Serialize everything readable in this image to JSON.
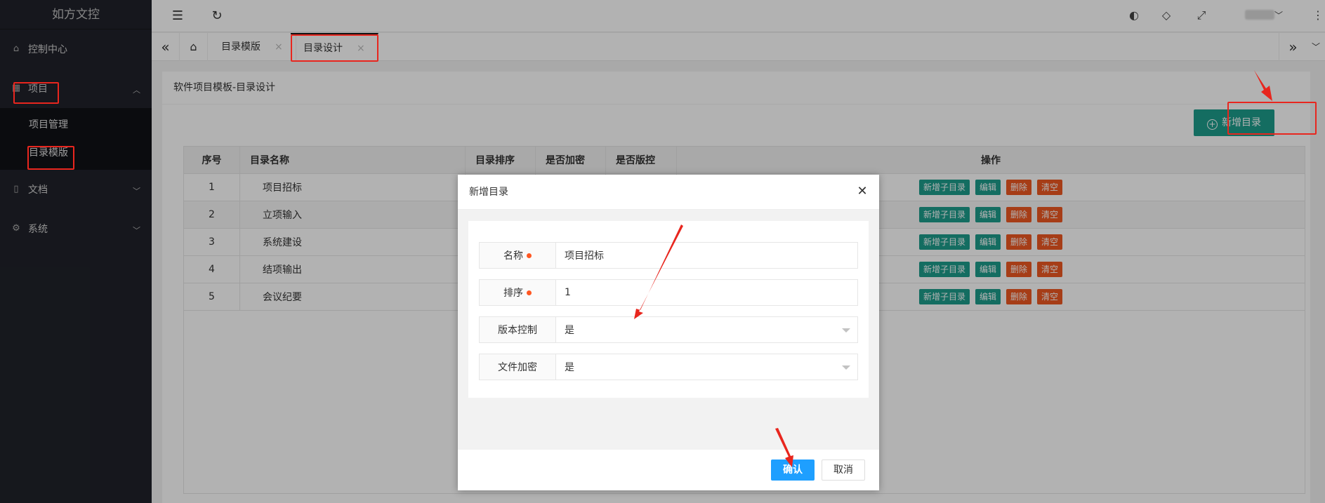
{
  "app": {
    "title": "如方文控"
  },
  "sidebar": {
    "items": [
      {
        "label": "控制中心",
        "icon": "home-icon"
      },
      {
        "label": "项目",
        "icon": "apps-icon",
        "expanded": true,
        "children": [
          {
            "label": "项目管理"
          },
          {
            "label": "目录模版"
          }
        ]
      },
      {
        "label": "文档",
        "icon": "file-icon"
      },
      {
        "label": "系统",
        "icon": "gear-icon"
      }
    ]
  },
  "tabs": [
    {
      "label": "目录模版",
      "close": "×"
    },
    {
      "label": "目录设计",
      "close": "×",
      "active": true
    }
  ],
  "page": {
    "breadcrumb": "软件项目模板-目录设计",
    "add_button": "新增目录"
  },
  "table": {
    "headers": [
      "序号",
      "目录名称",
      "目录排序",
      "是否加密",
      "是否版控",
      "操作"
    ],
    "rows": [
      {
        "idx": "1",
        "name": "项目招标"
      },
      {
        "idx": "2",
        "name": "立项输入"
      },
      {
        "idx": "3",
        "name": "系统建设"
      },
      {
        "idx": "4",
        "name": "结项输出"
      },
      {
        "idx": "5",
        "name": "会议纪要"
      }
    ],
    "ops": {
      "add_child": "新增子目录",
      "edit": "编辑",
      "delete": "删除",
      "clear": "清空"
    }
  },
  "modal": {
    "title": "新增目录",
    "fields": [
      {
        "label": "名称",
        "value": "项目招标",
        "required": true
      },
      {
        "label": "排序",
        "value": "1",
        "required": true
      },
      {
        "label": "版本控制",
        "value": "是",
        "select": true
      },
      {
        "label": "文件加密",
        "value": "是",
        "select": true
      }
    ],
    "confirm": "确认",
    "cancel": "取消"
  },
  "colors": {
    "accent": "#1e9c8c",
    "danger": "#ee5822",
    "primary": "#1e9fff",
    "annotation": "#e8261e"
  }
}
